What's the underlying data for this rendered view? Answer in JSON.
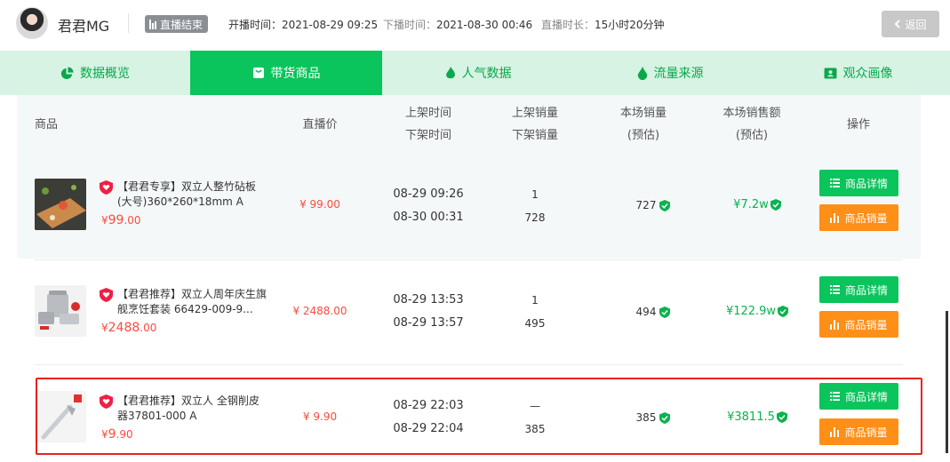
{
  "header": {
    "anchor_name": "君君MG",
    "status": "直播结束",
    "start_label": "开播时间：",
    "start_value": "2021-08-29 09:25",
    "end_label": "下播时间：",
    "end_value": "2021-08-30 00:46",
    "duration_label": "直播时长：",
    "duration_value": "15小时20分钟",
    "back_label": "返回"
  },
  "tabs": [
    {
      "label": "数据概览",
      "icon": "pie-chart-icon"
    },
    {
      "label": "带货商品",
      "icon": "shopping-bag-icon",
      "active": true
    },
    {
      "label": "人气数据",
      "icon": "flame-icon"
    },
    {
      "label": "流量来源",
      "icon": "droplet-icon"
    },
    {
      "label": "观众画像",
      "icon": "id-card-icon"
    }
  ],
  "table": {
    "headers": {
      "product": "商品",
      "live_price": "直播价",
      "list_time": "上架时间",
      "delist_time": "下架时间",
      "list_volume": "上架销量",
      "delist_volume": "下架销量",
      "session_sales": "本场销量",
      "session_sales_sub": "(预估)",
      "session_revenue": "本场销售额",
      "session_revenue_sub": "(预估)",
      "actions": "操作"
    },
    "detail_label": "商品详情",
    "sales_label": "商品销量",
    "rows": [
      {
        "name": "【君君专享】双立人整竹砧板(大号)360*260*18mm A",
        "price_symbol": "¥",
        "price": "99",
        "price_dec": ".00",
        "live_price": "¥ 99.00",
        "list_time": "08-29 09:26",
        "delist_time": "08-30 00:31",
        "list_volume": "1",
        "delist_volume": "728",
        "sales": "727",
        "revenue": "¥7.2w",
        "colors": {
          "board": "#c98a4c",
          "bg": "#3d3d38"
        }
      },
      {
        "name": "【君君推荐】双立人周年庆生旗舰烹饪套装 66429-009-9...",
        "price_symbol": "¥",
        "price": "2488",
        "price_dec": ".00",
        "live_price": "¥ 2488.00",
        "list_time": "08-29 13:53",
        "delist_time": "08-29 13:57",
        "list_volume": "1",
        "delist_volume": "495",
        "sales": "494",
        "revenue": "¥122.9w",
        "colors": {
          "pot": "#b9bcc0",
          "accent": "#d92b2b"
        }
      },
      {
        "name": "【君君推荐】双立人 全钢削皮器37801-000 A",
        "price_symbol": "¥",
        "price": "9",
        "price_dec": ".90",
        "live_price": "¥ 9.90",
        "list_time": "08-29 22:03",
        "delist_time": "08-29 22:04",
        "list_volume": "—",
        "delist_volume": "385",
        "sales": "385",
        "revenue": "¥3811.5",
        "colors": {
          "peeler": "#c9ccd0"
        }
      }
    ]
  },
  "colors": {
    "accent_green": "#0ac45c",
    "tab_bg": "#d7f3e3",
    "price_red": "#ff4a3d",
    "button_orange": "#ff8f17",
    "highlight_border": "#e62222"
  }
}
